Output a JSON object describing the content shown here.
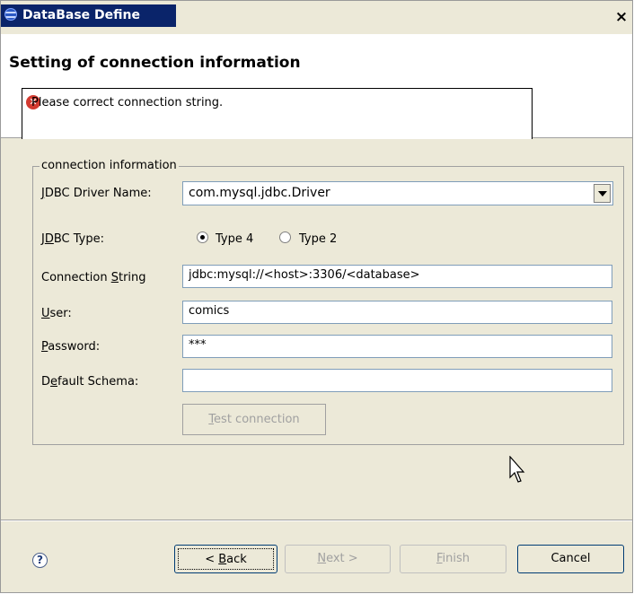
{
  "window": {
    "title": "DataBase Define",
    "close_glyph": "×"
  },
  "banner": {
    "page_title": "Setting of connection information",
    "message": "Please correct connection string.",
    "message_icon": "error-icon"
  },
  "group": {
    "legend": "connection information"
  },
  "form": {
    "driver_label": "JDBC Driver Name:",
    "driver_value": "com.mysql.jdbc.Driver",
    "type_label": "JDBC Type:",
    "type4_label": "Type 4",
    "type2_label": "Type 2",
    "type_selected": "Type 4",
    "conn_label": "Connection String",
    "conn_value": "jdbc:mysql://<host>:3306/<database>",
    "user_label": "User:",
    "user_value": "comics",
    "password_label": "Password:",
    "password_value": "***",
    "schema_label": "Default Schema:",
    "schema_value": "",
    "test_button": "Test connection"
  },
  "footer": {
    "help_glyph": "?",
    "back_button": "< Back",
    "next_button": "Next >",
    "finish_button": "Finish",
    "cancel_button": "Cancel"
  }
}
